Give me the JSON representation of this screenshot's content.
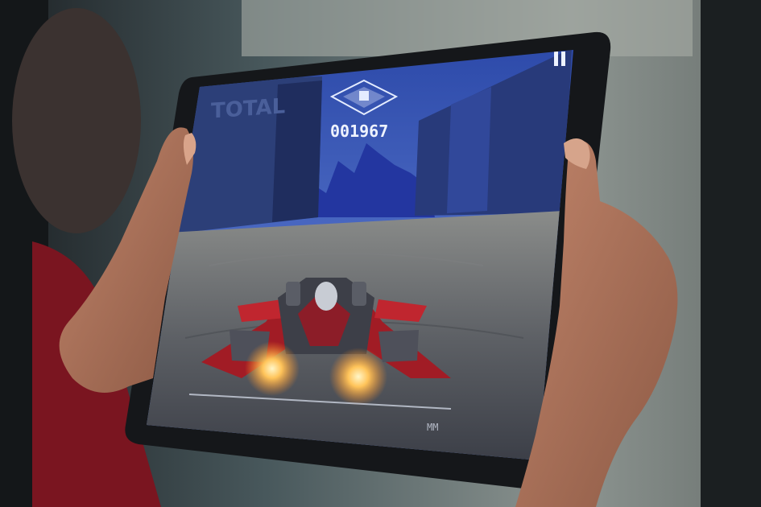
{
  "game": {
    "score": "001967",
    "wall_text": "TOTAL",
    "hud_right_label": "MM",
    "pause_icon": "pause-icon",
    "badge_icon": "rank-badge-icon"
  },
  "colors": {
    "sky": "#3f63c8",
    "ground": "#6b6f73",
    "ship_red": "#b0202a",
    "thruster": "#ffd27a",
    "tablet_bezel": "#15171a",
    "shirt": "#7a1520"
  }
}
